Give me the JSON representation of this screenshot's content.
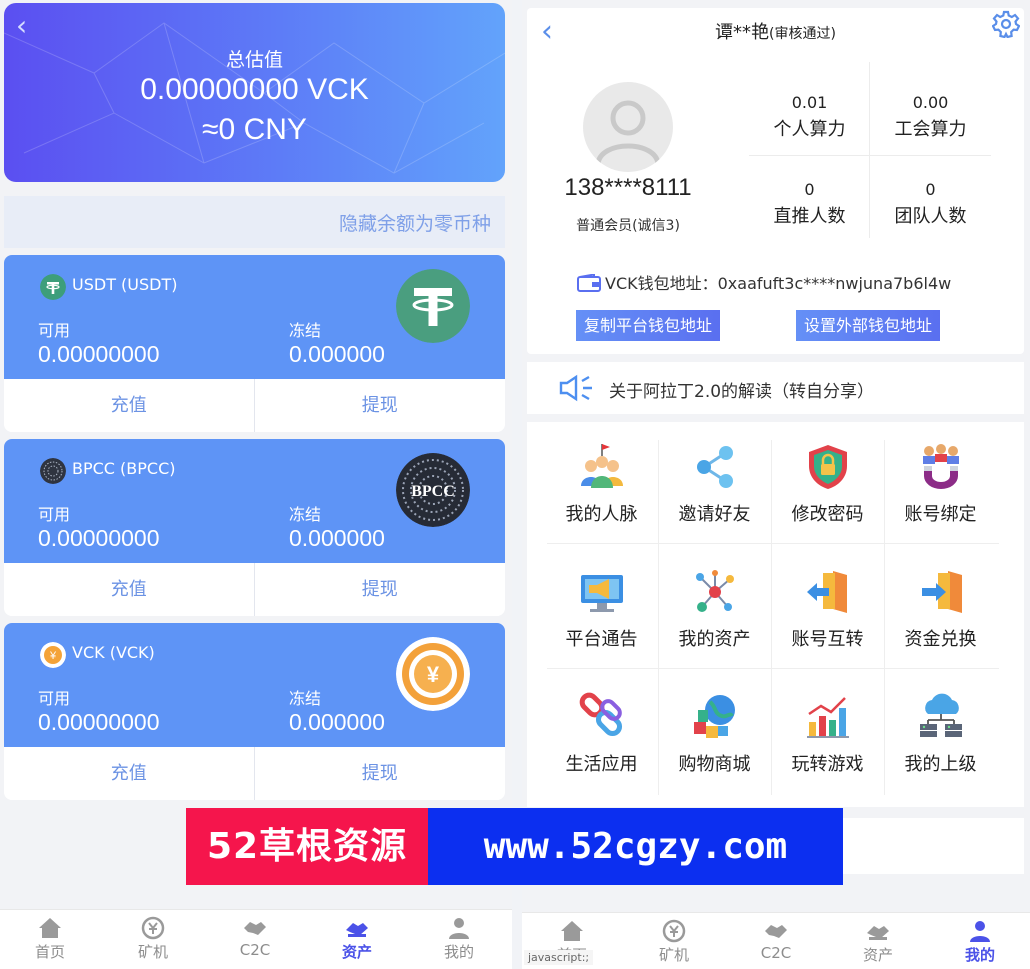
{
  "left": {
    "back_icon": "chevron-left-icon",
    "total_label": "总估值",
    "total_value": "0.00000000 VCK",
    "total_cny": "≈0 CNY",
    "hide_zero_label": "隐藏余额为零币种",
    "assets": [
      {
        "name": "USDT (USDT)",
        "avail_label": "可用",
        "avail": "0.00000000",
        "frozen_label": "冻结",
        "frozen": "0.000000",
        "deposit": "充值",
        "withdraw": "提现",
        "icon": "tether-icon"
      },
      {
        "name": "BPCC (BPCC)",
        "avail_label": "可用",
        "avail": "0.00000000",
        "frozen_label": "冻结",
        "frozen": "0.000000",
        "deposit": "充值",
        "withdraw": "提现",
        "icon": "bpcc-icon",
        "logo_text": "BPCC"
      },
      {
        "name": "VCK (VCK)",
        "avail_label": "可用",
        "avail": "0.00000000",
        "frozen_label": "冻结",
        "frozen": "0.000000",
        "deposit": "充值",
        "withdraw": "提现",
        "icon": "yen-coin-icon",
        "logo_text": "¥"
      }
    ],
    "tabs": [
      {
        "label": "首页",
        "icon": "home-icon",
        "active": false
      },
      {
        "label": "矿机",
        "icon": "miner-icon",
        "active": false
      },
      {
        "label": "C2C",
        "icon": "handshake-icon",
        "active": false
      },
      {
        "label": "资产",
        "icon": "assets-icon",
        "active": true
      },
      {
        "label": "我的",
        "icon": "user-icon",
        "active": false
      }
    ]
  },
  "right": {
    "title": "谭**艳",
    "title_status": "(审核通过)",
    "phone": "138****8111",
    "member": "普通会员(诚信3)",
    "stats": [
      {
        "value": "0.01",
        "label": "个人算力"
      },
      {
        "value": "0.00",
        "label": "工会算力"
      },
      {
        "value": "0",
        "label": "直推人数"
      },
      {
        "value": "0",
        "label": "团队人数"
      }
    ],
    "wallet_text": "VCK钱包地址：0xaafuft3c****nwjuna7b6l4w",
    "copy_button": "复制平台钱包地址",
    "set_button": "设置外部钱包地址",
    "notice": "关于阿拉丁2.0的解读（转自分享）",
    "grid": [
      {
        "label": "我的人脉",
        "icon": "network-people-icon"
      },
      {
        "label": "邀请好友",
        "icon": "share-icon"
      },
      {
        "label": "修改密码",
        "icon": "shield-lock-icon"
      },
      {
        "label": "账号绑定",
        "icon": "magnet-users-icon"
      },
      {
        "label": "平台通告",
        "icon": "megaphone-icon"
      },
      {
        "label": "我的资产",
        "icon": "molecule-icon"
      },
      {
        "label": "账号互转",
        "icon": "transfer-out-icon"
      },
      {
        "label": "资金兑换",
        "icon": "transfer-in-icon"
      },
      {
        "label": "生活应用",
        "icon": "link-icon"
      },
      {
        "label": "购物商城",
        "icon": "globe-boxes-icon"
      },
      {
        "label": "玩转游戏",
        "icon": "bar-chart-icon"
      },
      {
        "label": "我的上级",
        "icon": "cloud-server-icon"
      }
    ],
    "tabs": [
      {
        "label": "首页",
        "icon": "home-icon",
        "active": false
      },
      {
        "label": "矿机",
        "icon": "miner-icon",
        "active": false
      },
      {
        "label": "C2C",
        "icon": "handshake-icon",
        "active": false
      },
      {
        "label": "资产",
        "icon": "assets-icon",
        "active": false
      },
      {
        "label": "我的",
        "icon": "user-icon",
        "active": true
      }
    ],
    "js_tip": "javascript:;"
  },
  "banner": {
    "left_text": "52草根资源",
    "right_text": "www.52cgzy.com"
  },
  "colors": {
    "accent": "#5e94f6",
    "active_tab": "#4b52e8",
    "button_text": "#6c93e4"
  }
}
